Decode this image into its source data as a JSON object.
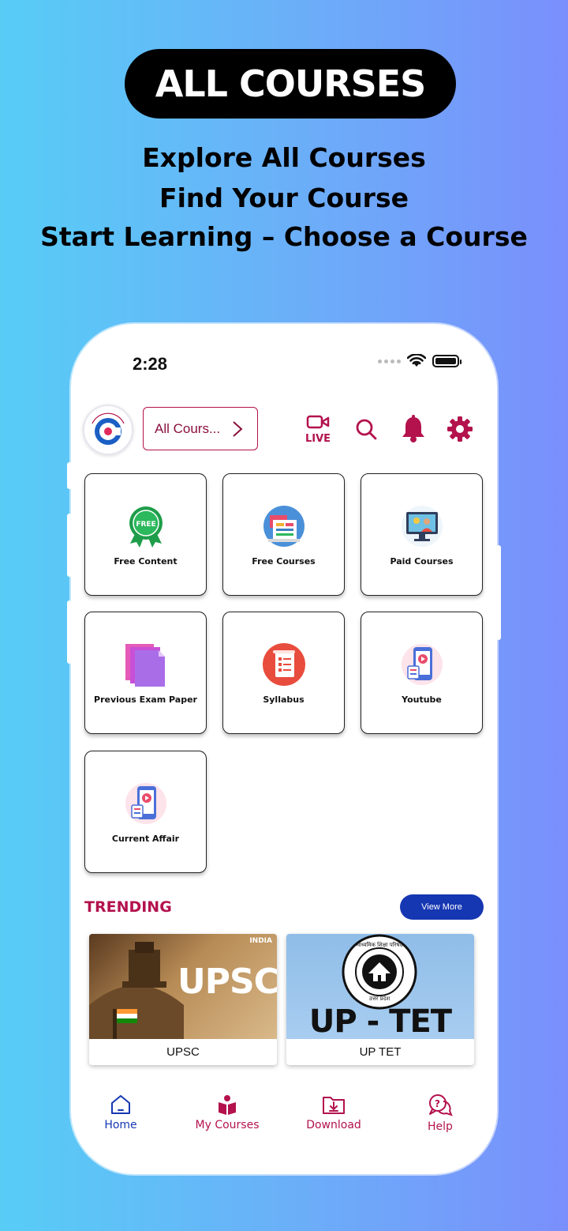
{
  "promo": {
    "badge": "ALL COURSES",
    "lines": [
      "Explore All Courses",
      "Find Your Course",
      "Start Learning – Choose a Course"
    ]
  },
  "status_bar": {
    "time": "2:28"
  },
  "header": {
    "course_selector": "All Cours...",
    "live_label": "LIVE"
  },
  "tiles": [
    {
      "label": "Free Content",
      "icon": "free-badge-icon"
    },
    {
      "label": "Free Courses",
      "icon": "books-icon"
    },
    {
      "label": "Paid Courses",
      "icon": "teacher-screen-icon"
    },
    {
      "label": "Previous Exam Paper",
      "icon": "papers-icon"
    },
    {
      "label": "Syllabus",
      "icon": "syllabus-icon"
    },
    {
      "label": "Youtube",
      "icon": "video-phone-icon"
    },
    {
      "label": "Current Affair",
      "icon": "news-phone-icon"
    }
  ],
  "trending": {
    "title": "TRENDING",
    "view_more": "View More",
    "cards": [
      {
        "caption": "UPSC",
        "banner_text": "UPSC",
        "corner_text": "INDIA"
      },
      {
        "caption": "UP TET",
        "banner_text": "UP - TET",
        "seal_text": "माध्यमिक शिक्षा परिषद",
        "seal_sub": "उत्तर प्रदेश"
      }
    ]
  },
  "bottom_nav": [
    {
      "label": "Home",
      "icon": "home-icon"
    },
    {
      "label": "My Courses",
      "icon": "book-reader-icon"
    },
    {
      "label": "Download",
      "icon": "download-folder-icon"
    },
    {
      "label": "Help",
      "icon": "help-chat-icon"
    }
  ],
  "colors": {
    "accent": "#b3124d",
    "nav_active": "#1637b2",
    "button_blue": "#1637b2"
  }
}
